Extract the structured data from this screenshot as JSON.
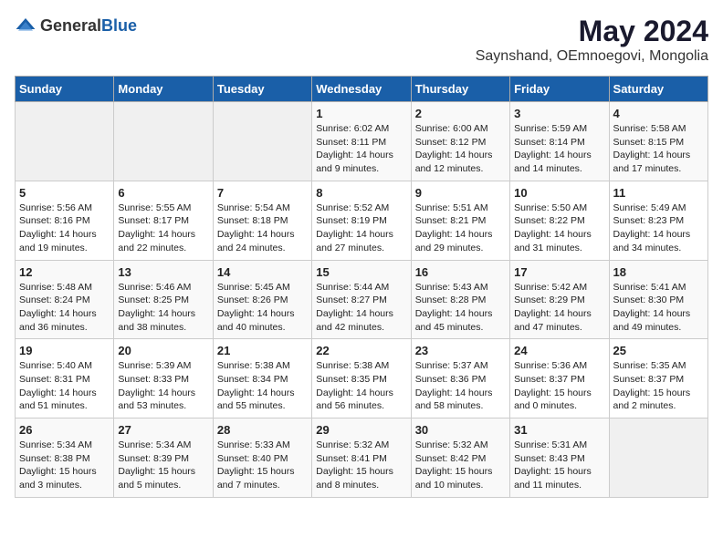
{
  "logo": {
    "general": "General",
    "blue": "Blue"
  },
  "title": "May 2024",
  "subtitle": "Saynshand, OEmnoegovi, Mongolia",
  "headers": [
    "Sunday",
    "Monday",
    "Tuesday",
    "Wednesday",
    "Thursday",
    "Friday",
    "Saturday"
  ],
  "weeks": [
    {
      "cells": [
        {
          "empty": true
        },
        {
          "empty": true
        },
        {
          "empty": true
        },
        {
          "day": 1,
          "sunrise": "6:02 AM",
          "sunset": "8:11 PM",
          "daylight": "14 hours and 9 minutes."
        },
        {
          "day": 2,
          "sunrise": "6:00 AM",
          "sunset": "8:12 PM",
          "daylight": "14 hours and 12 minutes."
        },
        {
          "day": 3,
          "sunrise": "5:59 AM",
          "sunset": "8:14 PM",
          "daylight": "14 hours and 14 minutes."
        },
        {
          "day": 4,
          "sunrise": "5:58 AM",
          "sunset": "8:15 PM",
          "daylight": "14 hours and 17 minutes."
        }
      ]
    },
    {
      "cells": [
        {
          "day": 5,
          "sunrise": "5:56 AM",
          "sunset": "8:16 PM",
          "daylight": "14 hours and 19 minutes."
        },
        {
          "day": 6,
          "sunrise": "5:55 AM",
          "sunset": "8:17 PM",
          "daylight": "14 hours and 22 minutes."
        },
        {
          "day": 7,
          "sunrise": "5:54 AM",
          "sunset": "8:18 PM",
          "daylight": "14 hours and 24 minutes."
        },
        {
          "day": 8,
          "sunrise": "5:52 AM",
          "sunset": "8:19 PM",
          "daylight": "14 hours and 27 minutes."
        },
        {
          "day": 9,
          "sunrise": "5:51 AM",
          "sunset": "8:21 PM",
          "daylight": "14 hours and 29 minutes."
        },
        {
          "day": 10,
          "sunrise": "5:50 AM",
          "sunset": "8:22 PM",
          "daylight": "14 hours and 31 minutes."
        },
        {
          "day": 11,
          "sunrise": "5:49 AM",
          "sunset": "8:23 PM",
          "daylight": "14 hours and 34 minutes."
        }
      ]
    },
    {
      "cells": [
        {
          "day": 12,
          "sunrise": "5:48 AM",
          "sunset": "8:24 PM",
          "daylight": "14 hours and 36 minutes."
        },
        {
          "day": 13,
          "sunrise": "5:46 AM",
          "sunset": "8:25 PM",
          "daylight": "14 hours and 38 minutes."
        },
        {
          "day": 14,
          "sunrise": "5:45 AM",
          "sunset": "8:26 PM",
          "daylight": "14 hours and 40 minutes."
        },
        {
          "day": 15,
          "sunrise": "5:44 AM",
          "sunset": "8:27 PM",
          "daylight": "14 hours and 42 minutes."
        },
        {
          "day": 16,
          "sunrise": "5:43 AM",
          "sunset": "8:28 PM",
          "daylight": "14 hours and 45 minutes."
        },
        {
          "day": 17,
          "sunrise": "5:42 AM",
          "sunset": "8:29 PM",
          "daylight": "14 hours and 47 minutes."
        },
        {
          "day": 18,
          "sunrise": "5:41 AM",
          "sunset": "8:30 PM",
          "daylight": "14 hours and 49 minutes."
        }
      ]
    },
    {
      "cells": [
        {
          "day": 19,
          "sunrise": "5:40 AM",
          "sunset": "8:31 PM",
          "daylight": "14 hours and 51 minutes."
        },
        {
          "day": 20,
          "sunrise": "5:39 AM",
          "sunset": "8:33 PM",
          "daylight": "14 hours and 53 minutes."
        },
        {
          "day": 21,
          "sunrise": "5:38 AM",
          "sunset": "8:34 PM",
          "daylight": "14 hours and 55 minutes."
        },
        {
          "day": 22,
          "sunrise": "5:38 AM",
          "sunset": "8:35 PM",
          "daylight": "14 hours and 56 minutes."
        },
        {
          "day": 23,
          "sunrise": "5:37 AM",
          "sunset": "8:36 PM",
          "daylight": "14 hours and 58 minutes."
        },
        {
          "day": 24,
          "sunrise": "5:36 AM",
          "sunset": "8:37 PM",
          "daylight": "15 hours and 0 minutes."
        },
        {
          "day": 25,
          "sunrise": "5:35 AM",
          "sunset": "8:37 PM",
          "daylight": "15 hours and 2 minutes."
        }
      ]
    },
    {
      "cells": [
        {
          "day": 26,
          "sunrise": "5:34 AM",
          "sunset": "8:38 PM",
          "daylight": "15 hours and 3 minutes."
        },
        {
          "day": 27,
          "sunrise": "5:34 AM",
          "sunset": "8:39 PM",
          "daylight": "15 hours and 5 minutes."
        },
        {
          "day": 28,
          "sunrise": "5:33 AM",
          "sunset": "8:40 PM",
          "daylight": "15 hours and 7 minutes."
        },
        {
          "day": 29,
          "sunrise": "5:32 AM",
          "sunset": "8:41 PM",
          "daylight": "15 hours and 8 minutes."
        },
        {
          "day": 30,
          "sunrise": "5:32 AM",
          "sunset": "8:42 PM",
          "daylight": "15 hours and 10 minutes."
        },
        {
          "day": 31,
          "sunrise": "5:31 AM",
          "sunset": "8:43 PM",
          "daylight": "15 hours and 11 minutes."
        },
        {
          "empty": true
        }
      ]
    }
  ],
  "labels": {
    "sunrise": "Sunrise:",
    "sunset": "Sunset:",
    "daylight": "Daylight:"
  }
}
